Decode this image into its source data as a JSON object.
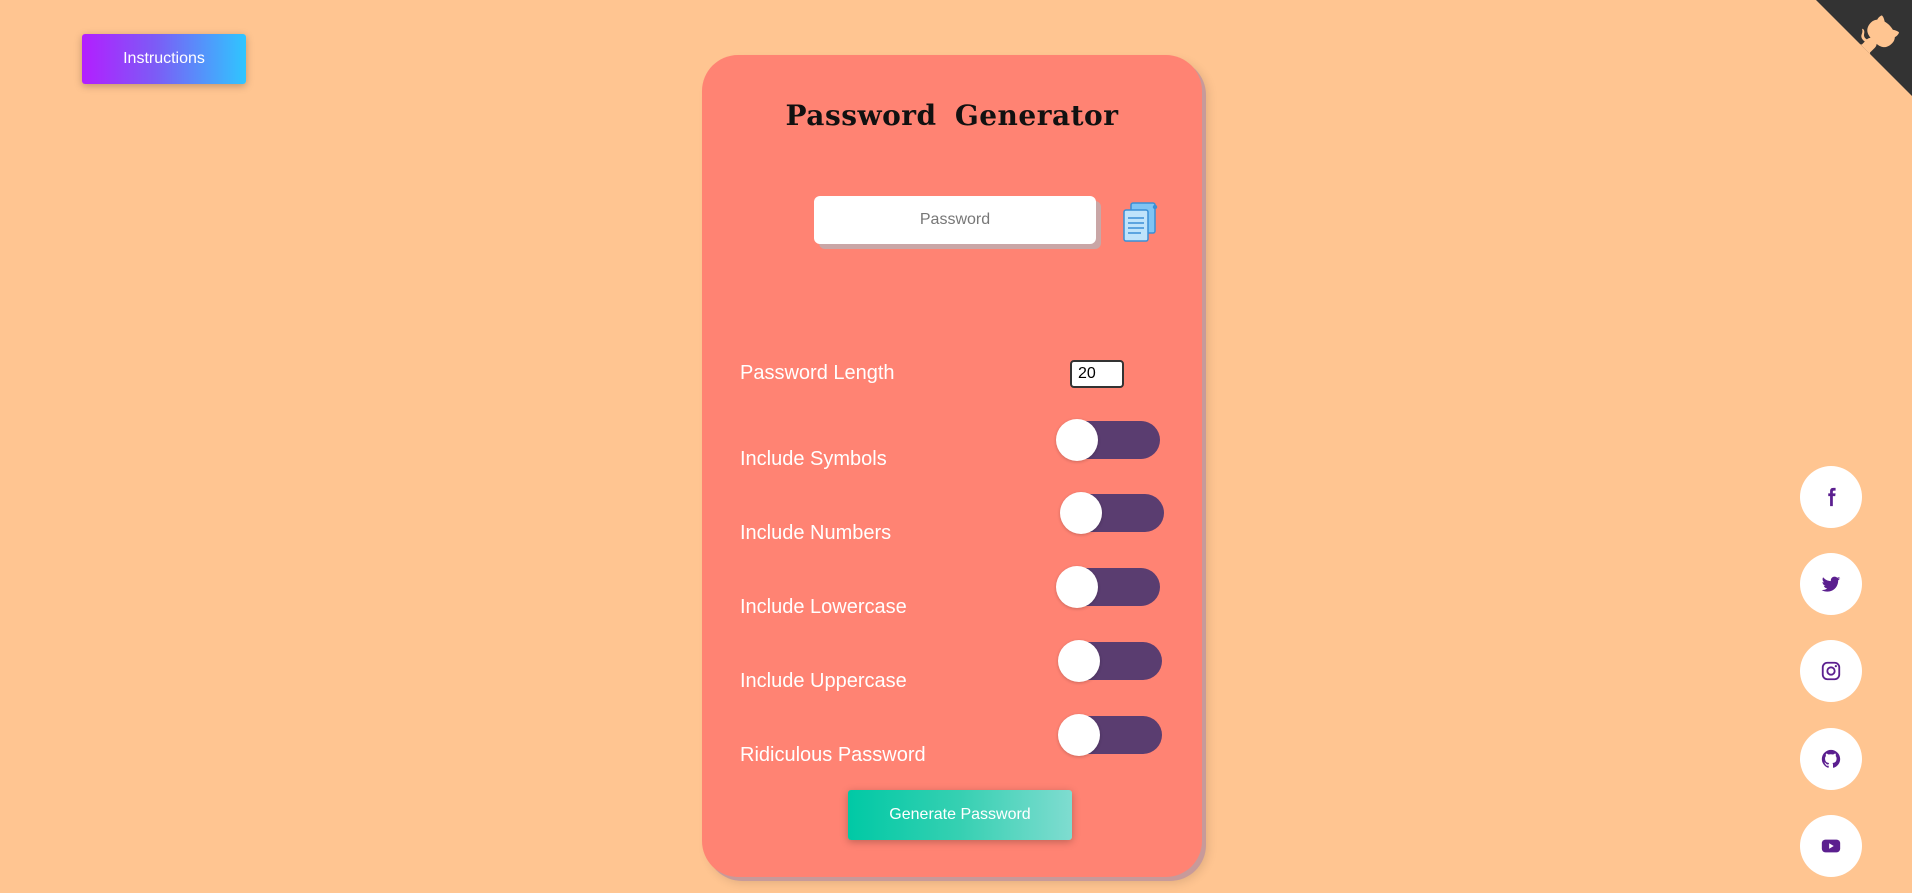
{
  "header": {
    "instructions_label": "Instructions"
  },
  "card": {
    "title": "Password  Generator",
    "password_placeholder": "Password",
    "password_value": ""
  },
  "options": {
    "length_label": "Password Length",
    "length_value": "20",
    "toggles": [
      {
        "label": "Include Symbols",
        "enabled": false
      },
      {
        "label": "Include Numbers",
        "enabled": false
      },
      {
        "label": "Include Lowercase",
        "enabled": false
      },
      {
        "label": "Include Uppercase",
        "enabled": false
      },
      {
        "label": "Ridiculous Password",
        "enabled": false
      }
    ]
  },
  "actions": {
    "generate_label": "Generate Password"
  },
  "icons": {
    "copy": "clipboard-icon",
    "github_corner": "github-octocat-icon",
    "social": [
      "facebook-icon",
      "twitter-icon",
      "instagram-icon",
      "github-icon",
      "youtube-icon"
    ]
  },
  "colors": {
    "background": "#ffc591",
    "card": "#ff8373",
    "toggle_track": "#5a3d70",
    "social_icon": "#5b1f8f"
  }
}
